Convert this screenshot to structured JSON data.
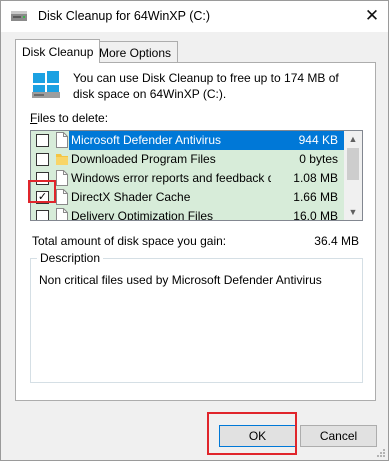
{
  "window": {
    "title": "Disk Cleanup for 64WinXP  (C:)",
    "close_glyph": "✕"
  },
  "tabs": [
    {
      "label": "Disk Cleanup",
      "active": true
    },
    {
      "label": "More Options",
      "active": false
    }
  ],
  "intro": {
    "text": "You can use Disk Cleanup to free up to 174 MB of disk space on 64WinXP  (C:)."
  },
  "files_label": {
    "accel": "F",
    "rest": "iles to delete:"
  },
  "files": [
    {
      "name": "Microsoft Defender Antivirus",
      "size": "944 KB",
      "checked": false,
      "selected": true,
      "icon": "file-icon"
    },
    {
      "name": "Downloaded Program Files",
      "size": "0 bytes",
      "checked": false,
      "selected": false,
      "icon": "folder-icon"
    },
    {
      "name": "Windows error reports and feedback di...",
      "size": "1.08 MB",
      "checked": false,
      "selected": false,
      "icon": "file-icon"
    },
    {
      "name": "DirectX Shader Cache",
      "size": "1.66 MB",
      "checked": true,
      "selected": false,
      "icon": "file-icon"
    },
    {
      "name": "Delivery Optimization Files",
      "size": "16.0 MB",
      "checked": false,
      "selected": false,
      "icon": "file-icon"
    }
  ],
  "total": {
    "label": "Total amount of disk space you gain:",
    "value": "36.4 MB"
  },
  "description": {
    "legend": "Description",
    "text": "Non critical files used by Microsoft Defender Antivirus"
  },
  "buttons": {
    "ok": "OK",
    "cancel": "Cancel"
  },
  "colors": {
    "row_bg": "#d7ecd9",
    "selection": "#0078d7",
    "annotation_red": "#e0252b"
  }
}
